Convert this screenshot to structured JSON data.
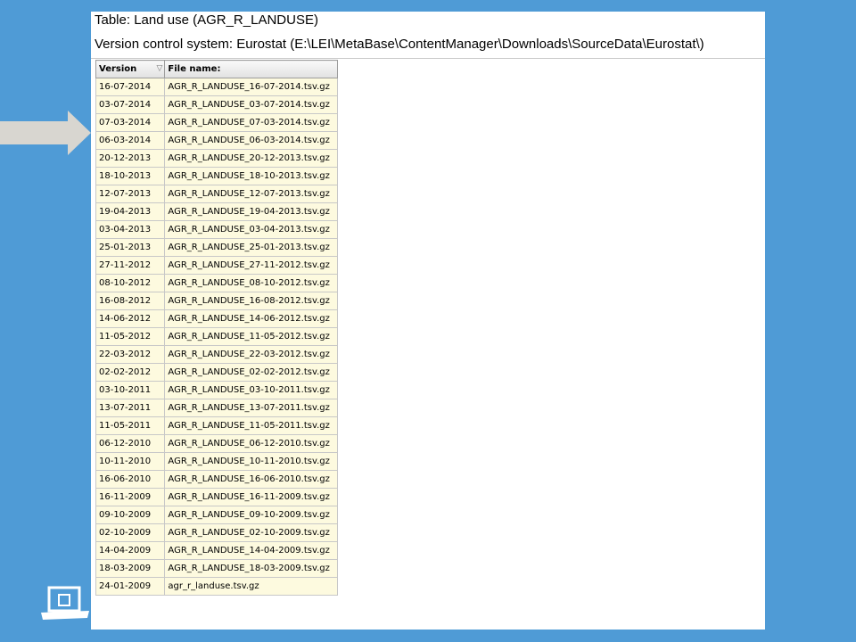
{
  "header": {
    "title": "Table: Land use (AGR_R_LANDUSE)",
    "vcs": "Version control system: Eurostat (E:\\LEI\\MetaBase\\ContentManager\\Downloads\\SourceData\\Eurostat\\)"
  },
  "table": {
    "columns": [
      "Version",
      "File name:"
    ],
    "sort_icon": "sort-descending-icon",
    "rows": [
      [
        "16-07-2014",
        "AGR_R_LANDUSE_16-07-2014.tsv.gz"
      ],
      [
        "03-07-2014",
        "AGR_R_LANDUSE_03-07-2014.tsv.gz"
      ],
      [
        "07-03-2014",
        "AGR_R_LANDUSE_07-03-2014.tsv.gz"
      ],
      [
        "06-03-2014",
        "AGR_R_LANDUSE_06-03-2014.tsv.gz"
      ],
      [
        "20-12-2013",
        "AGR_R_LANDUSE_20-12-2013.tsv.gz"
      ],
      [
        "18-10-2013",
        "AGR_R_LANDUSE_18-10-2013.tsv.gz"
      ],
      [
        "12-07-2013",
        "AGR_R_LANDUSE_12-07-2013.tsv.gz"
      ],
      [
        "19-04-2013",
        "AGR_R_LANDUSE_19-04-2013.tsv.gz"
      ],
      [
        "03-04-2013",
        "AGR_R_LANDUSE_03-04-2013.tsv.gz"
      ],
      [
        "25-01-2013",
        "AGR_R_LANDUSE_25-01-2013.tsv.gz"
      ],
      [
        "27-11-2012",
        "AGR_R_LANDUSE_27-11-2012.tsv.gz"
      ],
      [
        "08-10-2012",
        "AGR_R_LANDUSE_08-10-2012.tsv.gz"
      ],
      [
        "16-08-2012",
        "AGR_R_LANDUSE_16-08-2012.tsv.gz"
      ],
      [
        "14-06-2012",
        "AGR_R_LANDUSE_14-06-2012.tsv.gz"
      ],
      [
        "11-05-2012",
        "AGR_R_LANDUSE_11-05-2012.tsv.gz"
      ],
      [
        "22-03-2012",
        "AGR_R_LANDUSE_22-03-2012.tsv.gz"
      ],
      [
        "02-02-2012",
        "AGR_R_LANDUSE_02-02-2012.tsv.gz"
      ],
      [
        "03-10-2011",
        "AGR_R_LANDUSE_03-10-2011.tsv.gz"
      ],
      [
        "13-07-2011",
        "AGR_R_LANDUSE_13-07-2011.tsv.gz"
      ],
      [
        "11-05-2011",
        "AGR_R_LANDUSE_11-05-2011.tsv.gz"
      ],
      [
        "06-12-2010",
        "AGR_R_LANDUSE_06-12-2010.tsv.gz"
      ],
      [
        "10-11-2010",
        "AGR_R_LANDUSE_10-11-2010.tsv.gz"
      ],
      [
        "16-06-2010",
        "AGR_R_LANDUSE_16-06-2010.tsv.gz"
      ],
      [
        "16-11-2009",
        "AGR_R_LANDUSE_16-11-2009.tsv.gz"
      ],
      [
        "09-10-2009",
        "AGR_R_LANDUSE_09-10-2009.tsv.gz"
      ],
      [
        "02-10-2009",
        "AGR_R_LANDUSE_02-10-2009.tsv.gz"
      ],
      [
        "14-04-2009",
        "AGR_R_LANDUSE_14-04-2009.tsv.gz"
      ],
      [
        "18-03-2009",
        "AGR_R_LANDUSE_18-03-2009.tsv.gz"
      ],
      [
        "24-01-2009",
        "agr_r_landuse.tsv.gz"
      ]
    ]
  },
  "decor": {
    "arrow_icon": "arrow-right-icon",
    "logo_icon": "building-logo-icon"
  },
  "colors": {
    "background": "#4f9bd6",
    "panel": "#ffffff",
    "row_fill": "#fdfadf",
    "arrow": "#d8d6d0"
  }
}
